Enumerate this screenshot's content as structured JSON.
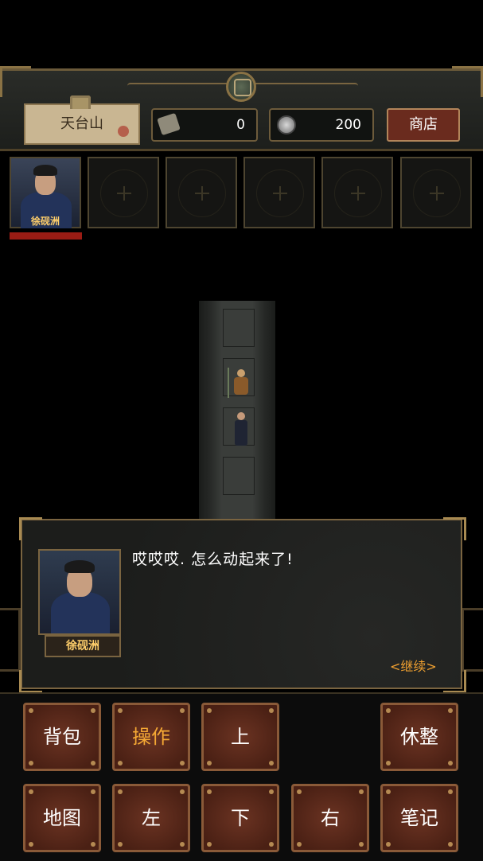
{
  "header": {
    "location": "天台山",
    "ticket_count": "0",
    "coin_count": "200",
    "shop_label": "商店"
  },
  "party": {
    "members": [
      {
        "name": "徐砚洲",
        "hp_fraction": 1.0
      }
    ],
    "empty_slots": 5
  },
  "dialog": {
    "speaker": "徐砚洲",
    "text": "哎哎哎. 怎么动起来了!",
    "continue_label": "<继续>"
  },
  "controls": {
    "bag": "背包",
    "operate": "操作",
    "up": "上",
    "rest": "休整",
    "map": "地图",
    "left": "左",
    "down": "下",
    "right": "右",
    "notes": "笔记"
  },
  "colors": {
    "gold_text": "#ffcf6b",
    "active_button_text": "#f4a834",
    "continue_text": "#f0a030",
    "hp_bar": "#9a1c14",
    "button_bg": "#5a2818"
  }
}
